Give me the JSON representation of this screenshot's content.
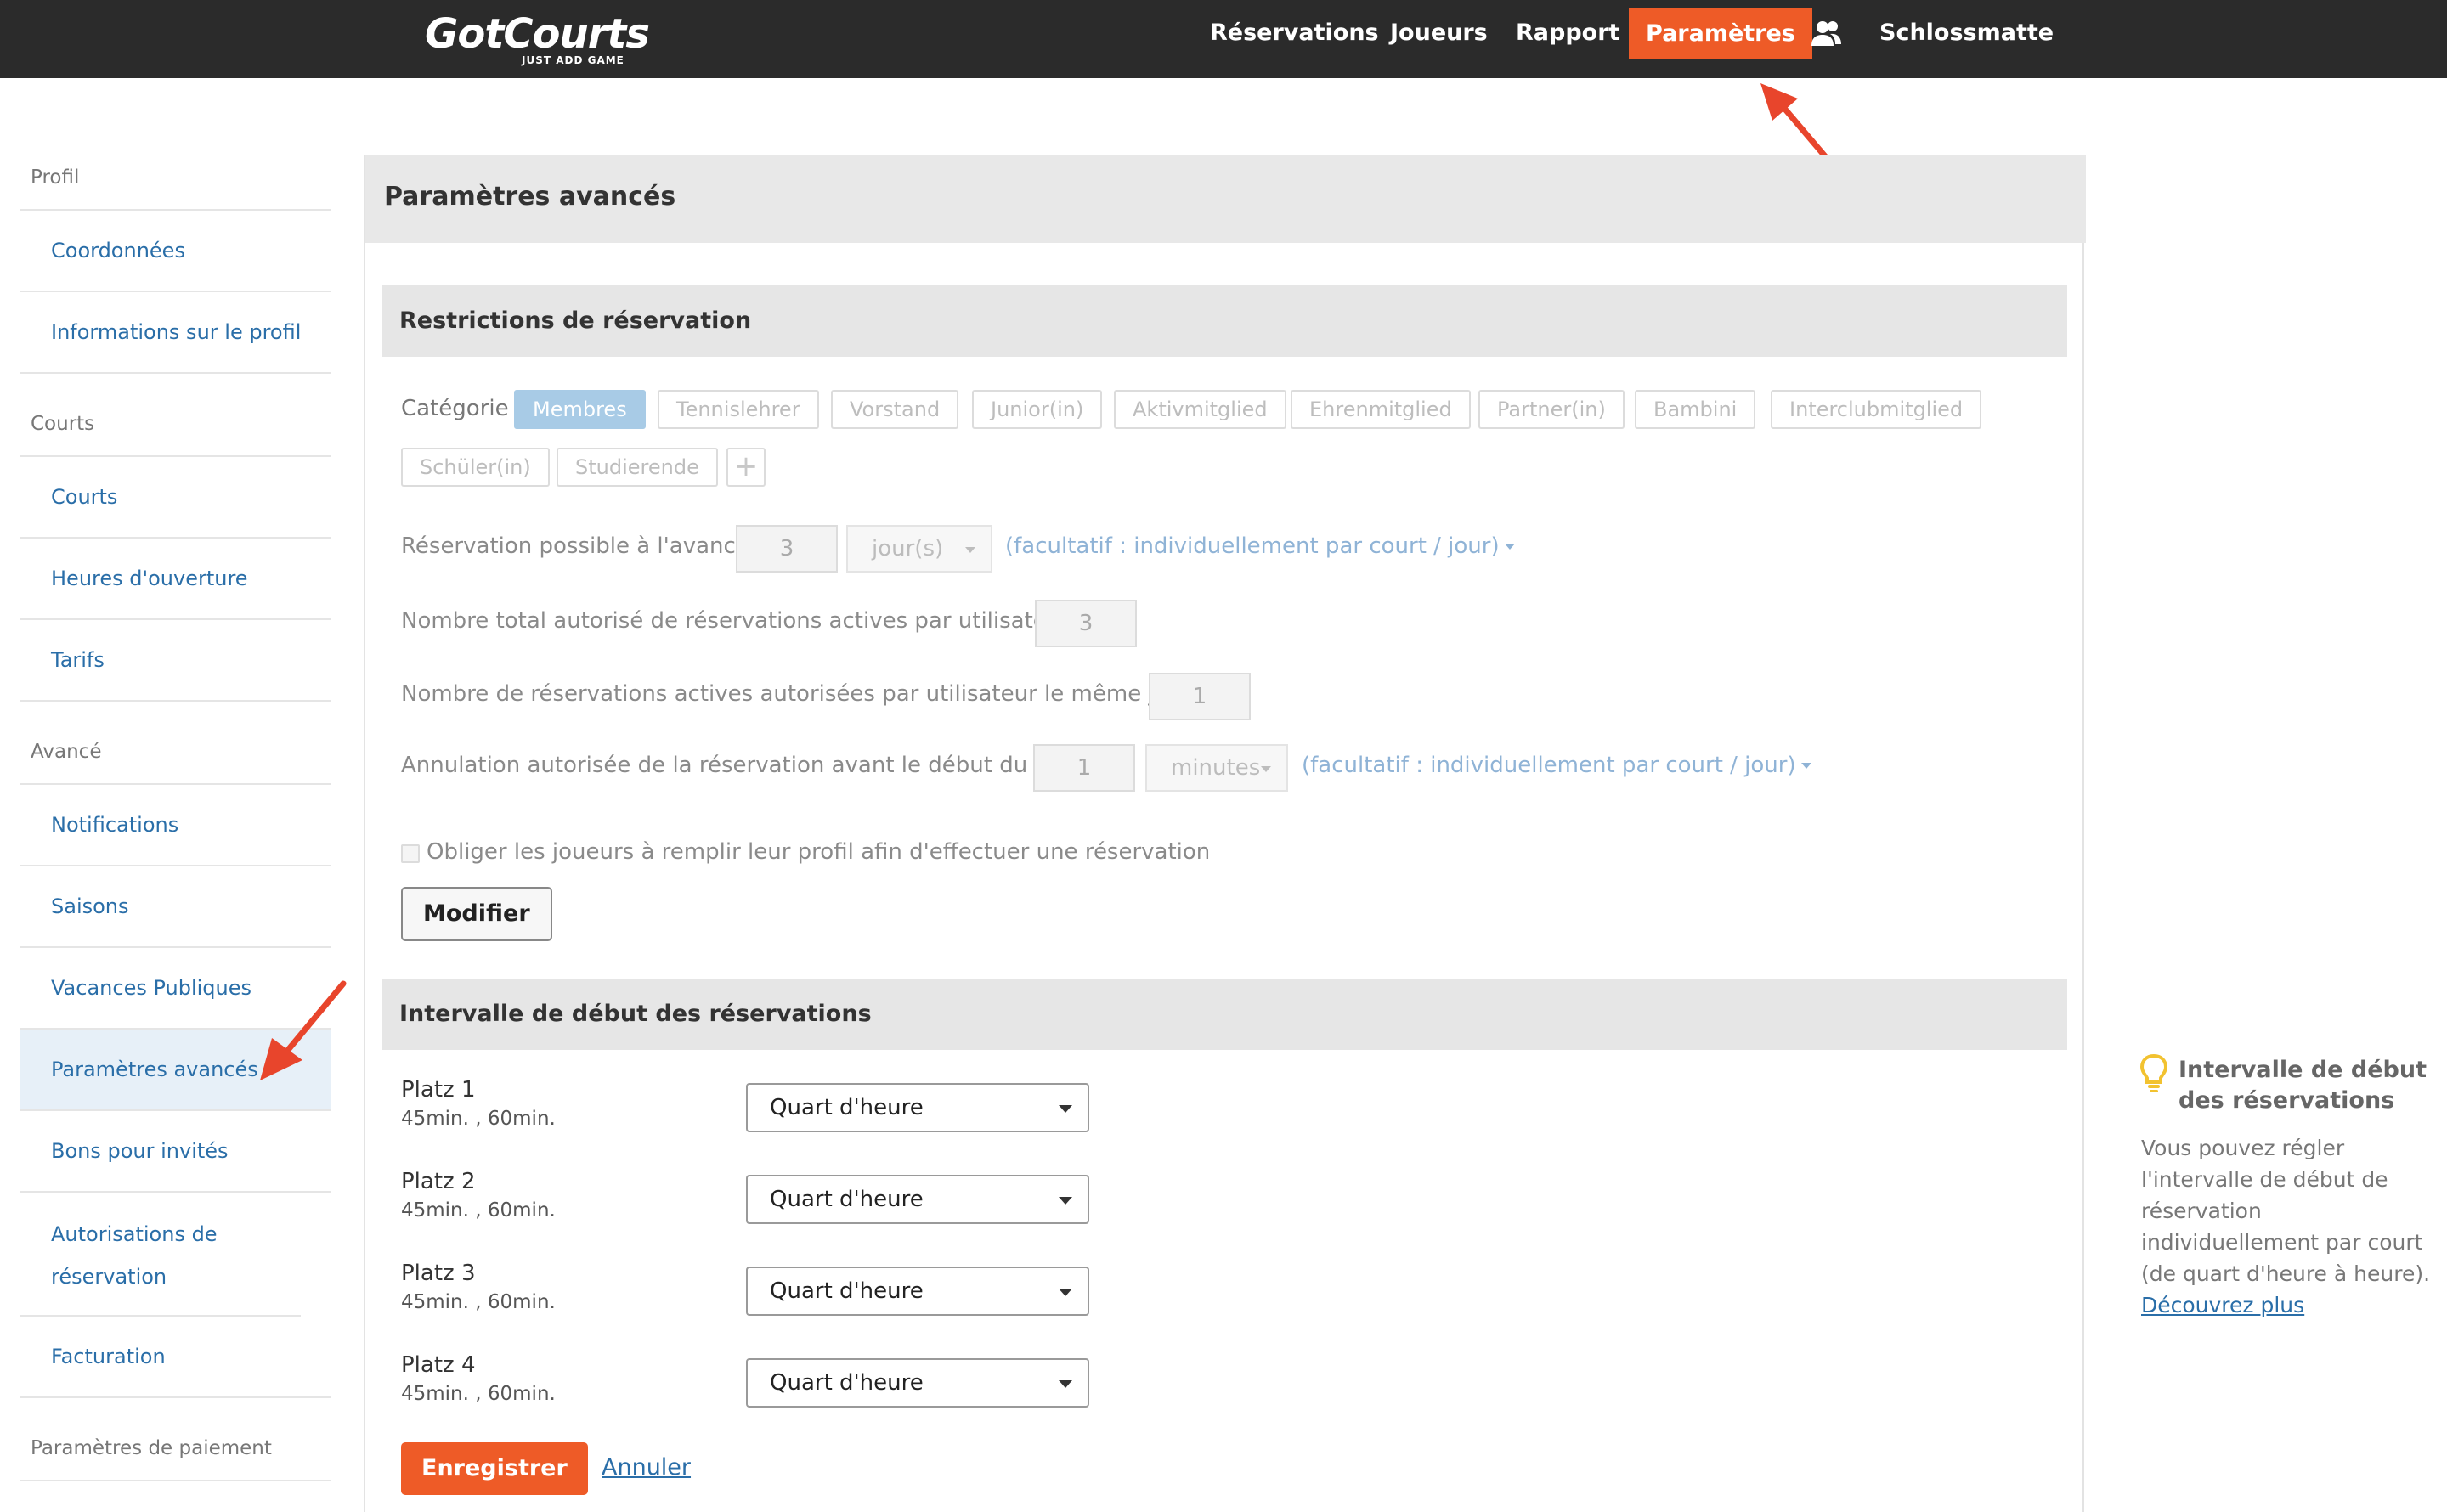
{
  "app": {
    "logo_main": "GotCourts",
    "logo_sub": "JUST ADD GAME"
  },
  "nav": {
    "items": [
      {
        "label": "Réservations"
      },
      {
        "label": "Joueurs"
      },
      {
        "label": "Rapport"
      },
      {
        "label": "Paramètres",
        "active": true
      }
    ],
    "users_icon": "users-icon",
    "club_name": "Schlossmatte"
  },
  "sidebar": {
    "sections": [
      {
        "title": "Profil",
        "items": [
          "Coordonnées",
          "Informations sur le profil"
        ]
      },
      {
        "title": "Courts",
        "items": [
          "Courts",
          "Heures d'ouverture",
          "Tarifs"
        ]
      },
      {
        "title": "Avancé",
        "items": [
          "Notifications",
          "Saisons",
          "Vacances Publiques",
          "Paramètres avancés",
          "Bons pour invités",
          "Autorisations de réservation",
          "Facturation"
        ]
      },
      {
        "title": "Paramètres de paiement",
        "items": []
      }
    ],
    "active_item": "Paramètres avancés"
  },
  "main": {
    "title": "Paramètres avancés",
    "restrictions": {
      "title": "Restrictions de réservation",
      "category_label": "Catégorie",
      "categories": [
        "Membres",
        "Tennislehrer",
        "Vorstand",
        "Junior(in)",
        "Aktivmitglied",
        "Ehrenmitglied",
        "Partner(in)",
        "Bambini",
        "Interclubmitglied",
        "Schüler(in)",
        "Studierende"
      ],
      "active_category": "Membres",
      "advance_label": "Réservation possible à l'avance :",
      "advance_value": "3",
      "advance_unit": "jour(s)",
      "advance_link": "(facultatif : individuellement par court / jour)",
      "total_active_label": "Nombre total autorisé de réservations actives par utilisateur :",
      "total_active_value": "3",
      "same_day_label": "Nombre de réservations actives autorisées par utilisateur le même jour :",
      "same_day_value": "1",
      "cancel_label": "Annulation autorisée de la réservation avant le début du jeu :",
      "cancel_value": "1",
      "cancel_unit": "minutes",
      "cancel_link": "(facultatif : individuellement par court / jour)",
      "profile_checkbox_label": "Obliger les joueurs à remplir leur profil afin d'effectuer une réservation",
      "modify_button": "Modifier"
    },
    "interval": {
      "title": "Intervalle de début des réservations",
      "courts": [
        {
          "name": "Platz 1",
          "durations": "45min. , 60min.",
          "value": "Quart d'heure"
        },
        {
          "name": "Platz 2",
          "durations": "45min. , 60min.",
          "value": "Quart d'heure"
        },
        {
          "name": "Platz 3",
          "durations": "45min. , 60min.",
          "value": "Quart d'heure"
        },
        {
          "name": "Platz 4",
          "durations": "45min. , 60min.",
          "value": "Quart d'heure"
        }
      ],
      "save_button": "Enregistrer",
      "cancel_link": "Annuler"
    }
  },
  "help": {
    "icon": "lightbulb-icon",
    "title": "Intervalle de début des réservations",
    "text": "Vous pouvez régler l'intervalle de début de réservation individuellement par court (de quart d'heure à heure).",
    "link": "Découvrez plus"
  },
  "colors": {
    "topbar": "#2b2b2b",
    "accent": "#ee5b27",
    "link": "#2a6ea8",
    "active_chip": "#a8cbe6",
    "arrow": "#e8452c"
  }
}
